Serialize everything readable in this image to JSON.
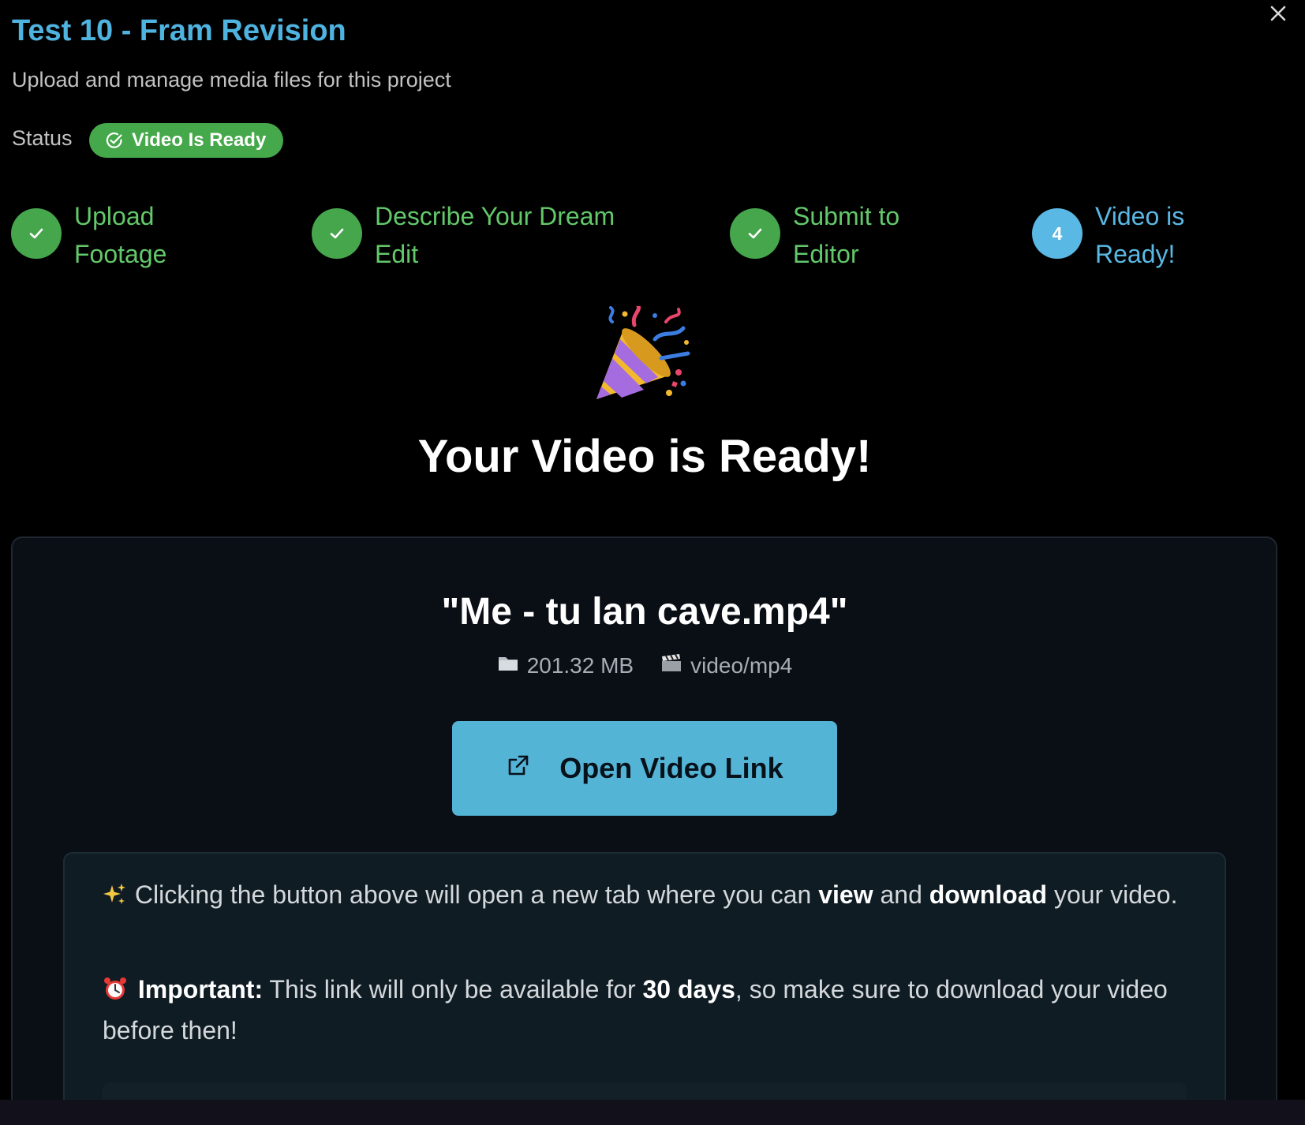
{
  "modal": {
    "title": "Test 10 - Fram Revision",
    "subtitle": "Upload and manage media files for this project",
    "status_label": "Status",
    "status_badge": "Video Is Ready",
    "close_icon": "close-icon"
  },
  "steps": [
    {
      "line1": "Upload",
      "line2": "Footage",
      "state": "done"
    },
    {
      "line1": "Describe Your Dream",
      "line2": "Edit",
      "state": "done"
    },
    {
      "line1": "Submit to",
      "line2": "Editor",
      "state": "done"
    },
    {
      "number": "4",
      "line1": "Video is",
      "line2": "Ready!",
      "state": "current"
    }
  ],
  "heading": "Your Video is Ready!",
  "file": {
    "name": "\"Me - tu lan cave.mp4\"",
    "size": "201.32 MB",
    "type": "video/mp4"
  },
  "open_button": {
    "label": "Open Video Link",
    "icon": "external-link-icon"
  },
  "info": {
    "p1_a": "Clicking the button above will open a new tab where you can ",
    "p1_view": "view",
    "p1_b": " and ",
    "p1_download": "download",
    "p1_c": " your video.",
    "p2_important": "Important:",
    "p2_a": " This link will only be available for ",
    "p2_days": "30 days",
    "p2_b": ", so make sure to download your video before then!"
  },
  "colors": {
    "title": "#4fb3e0",
    "success": "#46a64c",
    "current_step": "#5ab8e4",
    "button": "#53b4d6"
  }
}
